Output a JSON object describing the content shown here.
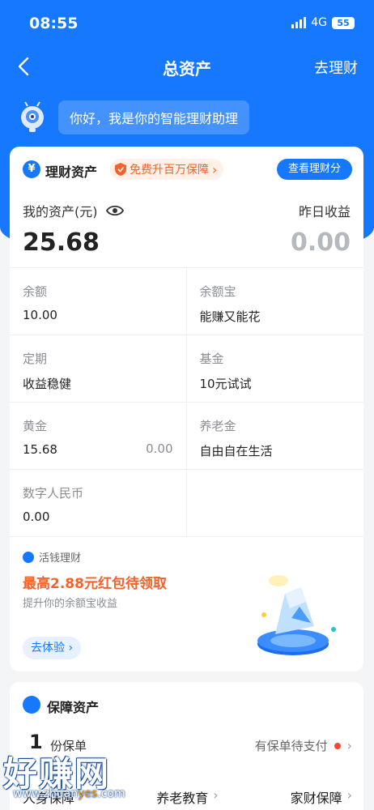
{
  "status_bar": {
    "time": "08:55",
    "network": "4G",
    "battery": "55"
  },
  "navbar": {
    "title": "总资产",
    "right_link": "去理财"
  },
  "assistant": {
    "greeting": "你好，我是你的智能理财助理"
  },
  "wealth_card": {
    "title": "理财资产",
    "promo": "免费升百万保障",
    "view_button": "查看理财分",
    "my_assets_label": "我的资产(元)",
    "my_assets_value": "25.68",
    "yesterday_label": "昨日收益",
    "yesterday_value": "0.00",
    "items": [
      {
        "label": "余额",
        "value": "10.00"
      },
      {
        "label": "余额宝",
        "value": "能赚又能花"
      },
      {
        "label": "定期",
        "value": "收益稳健"
      },
      {
        "label": "基金",
        "value": "10元试试"
      },
      {
        "label": "黄金",
        "value": "15.68",
        "sub": "0.00"
      },
      {
        "label": "养老金",
        "value": "自由自在生活"
      },
      {
        "label": "数字人民币",
        "value": "0.00"
      }
    ],
    "promo_section": {
      "tag": "活钱理财",
      "headline": "最高2.88元红包待领取",
      "desc": "提升你的余额宝收益",
      "button": "去体验"
    }
  },
  "insurance_card": {
    "title": "保障资产",
    "count": "1",
    "unit": "份保单",
    "pending": "有保单待支付",
    "links": [
      "人身保障",
      "养老教育",
      "家财保障"
    ]
  },
  "watermark": {
    "text": "好赚网",
    "url_prefix": "www.zhuan",
    "url_highlight": "yes",
    "url_suffix": ".com"
  },
  "colors": {
    "brand": "#1677ff",
    "promo": "#f2632b",
    "muted": "#8a8d93"
  }
}
